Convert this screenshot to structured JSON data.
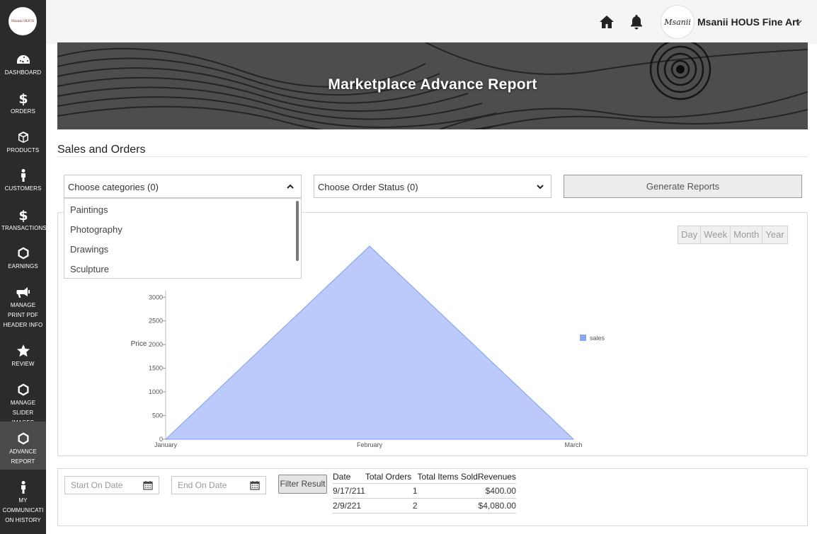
{
  "sidebar": {
    "logo_text": "Msanii HOUS",
    "items": [
      {
        "label": "DASHBOARD",
        "icon": "gauge-icon"
      },
      {
        "label": "ORDERS",
        "icon": "dollar-icon"
      },
      {
        "label": "PRODUCTS",
        "icon": "box-icon"
      },
      {
        "label": "CUSTOMERS",
        "icon": "person-icon"
      },
      {
        "label": "TRANSACTIONS",
        "icon": "dollar-icon"
      },
      {
        "label": "EARNINGS",
        "icon": "hexagon-icon"
      },
      {
        "label": "MANAGE PRINT PDF HEADER INFO",
        "icon": "megaphone-icon"
      },
      {
        "label": "REVIEW",
        "icon": "star-icon"
      },
      {
        "label": "MANAGE SLIDER IMAGES",
        "icon": "hexagon-icon"
      },
      {
        "label": "ADVANCE REPORT",
        "icon": "hexagon-icon"
      },
      {
        "label": "MY COMMUNICATI ON HISTORY",
        "icon": "person-icon"
      }
    ]
  },
  "header": {
    "user_name": "Msanii HOUS Fine Art",
    "avatar_text": "Msanii"
  },
  "banner": {
    "title": "Marketplace Advance Report"
  },
  "section": {
    "title": "Sales and Orders"
  },
  "filters": {
    "categories_label": "Choose categories (0)",
    "status_label": "Choose Order Status (0)",
    "generate_label": "Generate Reports",
    "category_options": [
      "Paintings",
      "Photography",
      "Drawings",
      "Sculpture"
    ]
  },
  "period": [
    "Day",
    "Week",
    "Month",
    "Year"
  ],
  "chart_data": {
    "type": "area",
    "categories": [
      "January",
      "February",
      "March"
    ],
    "series": [
      {
        "name": "sales",
        "values": [
          0,
          4080,
          0
        ],
        "color": "#bccafb",
        "stroke": "#8aa7f5"
      }
    ],
    "ylabel": "Price",
    "yticks": [
      0,
      500,
      1000,
      1500,
      2000,
      2500,
      3000
    ],
    "ylim": [
      0,
      4080
    ],
    "legend_position": "right",
    "grid": false
  },
  "results": {
    "start_placeholder": "Start On Date",
    "end_placeholder": "End On Date",
    "filter_label": "Filter Result",
    "columns": [
      "Date",
      "Total Orders",
      "Total Items Sold",
      "Revenues"
    ],
    "rows": [
      [
        "9/17/211",
        "1",
        "",
        "$400.00"
      ],
      [
        "2/9/221",
        "2",
        "",
        "$4,080.00"
      ]
    ]
  }
}
